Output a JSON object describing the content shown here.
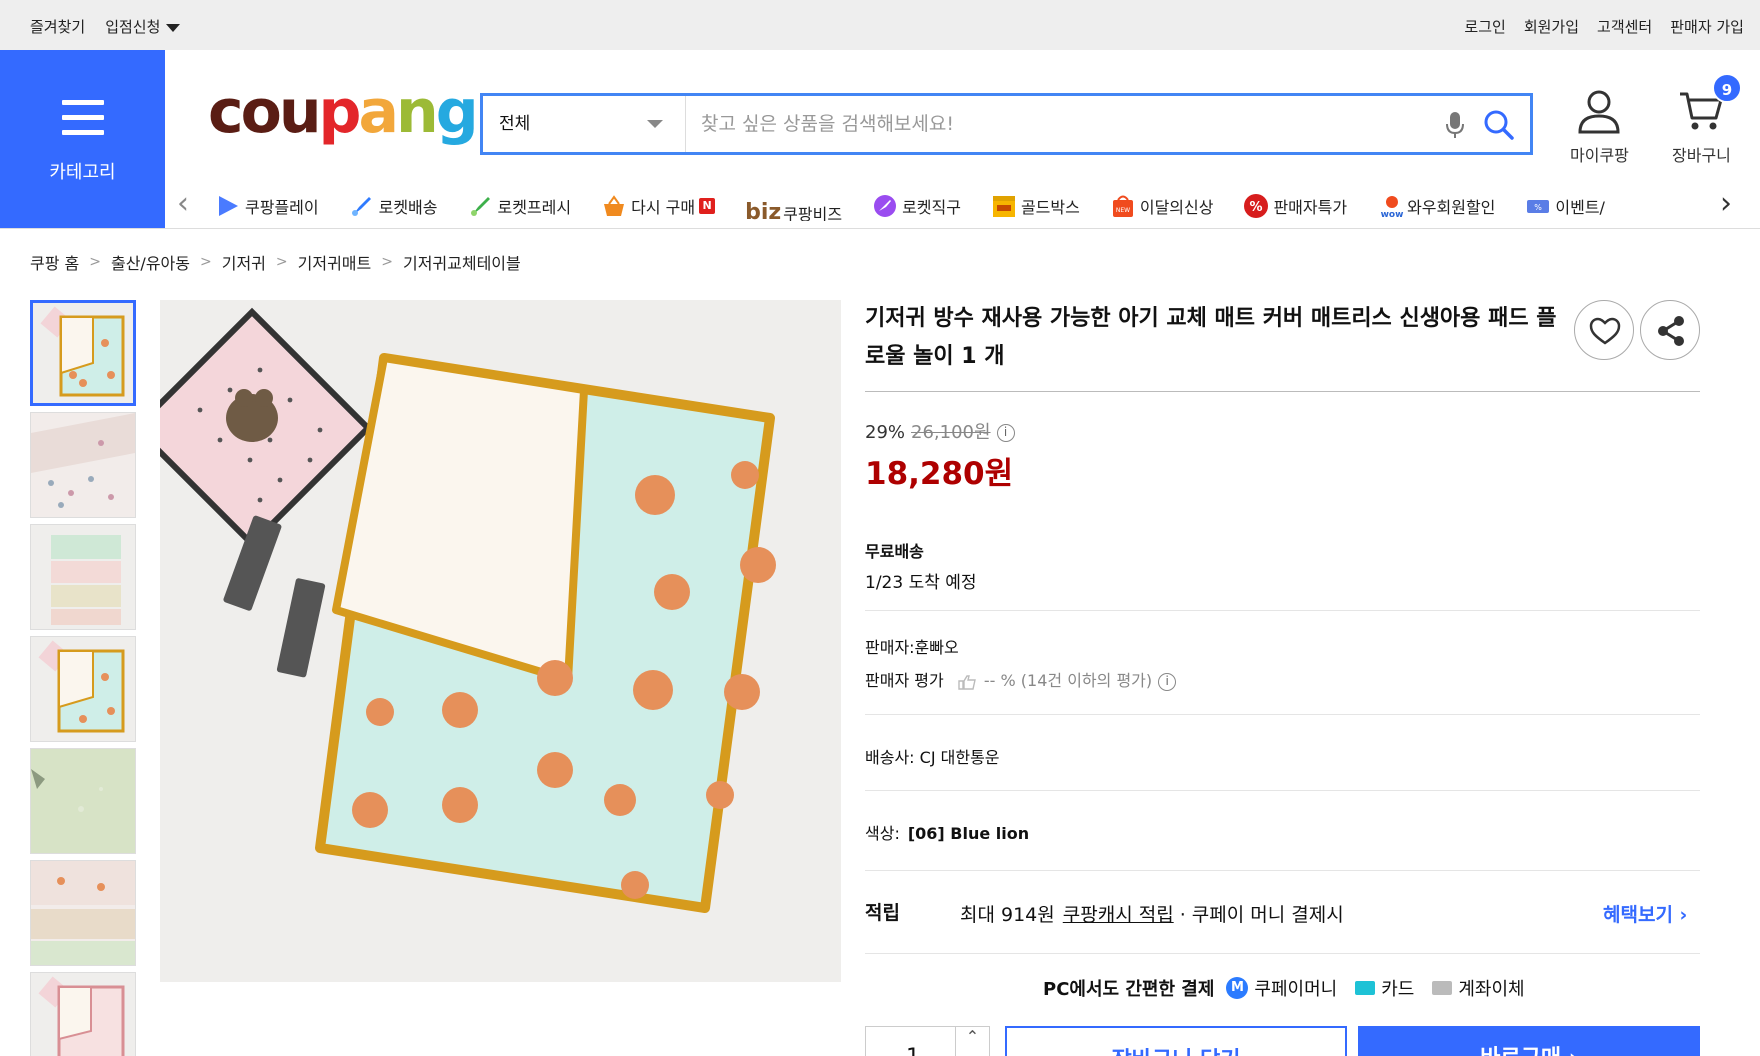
{
  "topbar": {
    "left": [
      "즐겨찾기",
      "입점신청"
    ],
    "right": [
      "로그인",
      "회원가입",
      "고객센터",
      "판매자 가입"
    ]
  },
  "header": {
    "category_label": "카테고리",
    "logo_letters": [
      "c",
      "o",
      "u",
      "p",
      "a",
      "n",
      "g"
    ],
    "logo_colors": [
      "#5a1d14",
      "#5a1d14",
      "#5a1d14",
      "#e3262a",
      "#f2a73b",
      "#9cba36",
      "#25a9e0"
    ],
    "search": {
      "scope": "전체",
      "placeholder": "찾고 싶은 상품을 검색해보세요!"
    },
    "mycoupang_label": "마이쿠팡",
    "cart_label": "장바구니",
    "cart_count": "9",
    "accent_color": "#346aff"
  },
  "category_strip": [
    {
      "label": "쿠팡플레이",
      "icon": "play-icon"
    },
    {
      "label": "로켓배송",
      "icon": "rocket-icon"
    },
    {
      "label": "로켓프레시",
      "icon": "rocket-fresh-icon"
    },
    {
      "label": "다시 구매",
      "icon": "rebuy-basket-icon",
      "badge": "N"
    },
    {
      "label": "쿠팡비즈",
      "icon": "biz-icon",
      "prefix": "biz"
    },
    {
      "label": "로켓직구",
      "icon": "rocket-global-icon"
    },
    {
      "label": "골드박스",
      "icon": "goldbox-icon"
    },
    {
      "label": "이달의신상",
      "icon": "new-bag-icon"
    },
    {
      "label": "판매자특가",
      "icon": "percent-badge-icon"
    },
    {
      "label": "와우회원할인",
      "icon": "wow-icon"
    },
    {
      "label": "이벤트/",
      "icon": "event-ticket-icon"
    }
  ],
  "breadcrumb": [
    "쿠팡 홈",
    "출산/유아동",
    "기저귀",
    "기저귀매트",
    "기저귀교체테이블"
  ],
  "product": {
    "title": "기저귀 방수 재사용 가능한 아기 교체 매트 커버 매트리스 신생아용 패드 플로울 놀이 1 개",
    "discount_rate": "29%",
    "original_price": "26,100원",
    "price": "18,280원",
    "price_color": "#ae0000",
    "shipping_title": "무료배송",
    "arrival": "1/23 도착 예정",
    "seller": "판매자:훈빠오",
    "seller_rating_label": "판매자 평가",
    "seller_rating_value": "-- % (14건 이하의 평가)",
    "carrier_label": "배송사:",
    "carrier": "CJ 대한통운",
    "color_label": "색상:",
    "color_value": "[06] Blue lion",
    "reward_title": "적립",
    "reward_amount": "최대 914원",
    "reward_link": "쿠팡캐시 적립",
    "reward_suffix": "· 쿠페이 머니 결제시",
    "benefit_link": "혜택보기",
    "pay_lead": "PC에서도 간편한 결제",
    "pay_methods": [
      "쿠페이머니",
      "카드",
      "계좌이체"
    ],
    "qty": "1",
    "cart_button": "장바구니 담기",
    "buy_button": "바로구매"
  }
}
